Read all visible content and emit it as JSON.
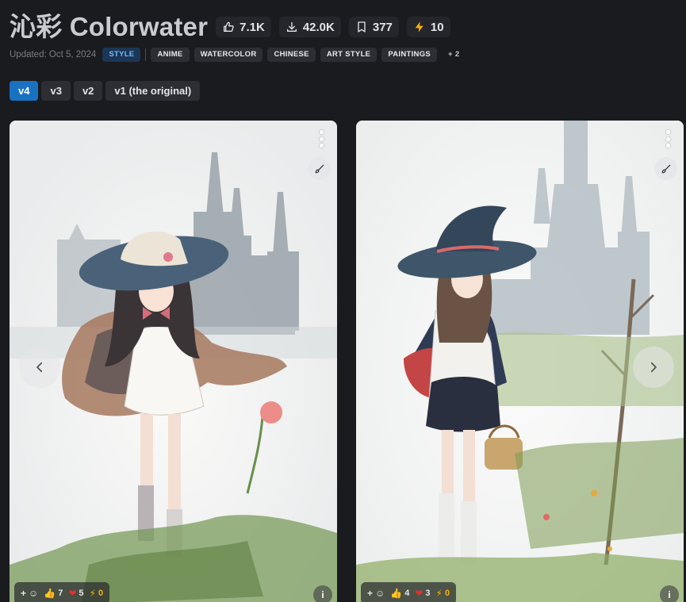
{
  "model": {
    "title": "沁彩 Colorwater",
    "stats": {
      "likes": "7.1K",
      "downloads": "42.0K",
      "bookmarks": "377",
      "buzz": "10"
    },
    "updated": "Updated: Oct 5, 2024",
    "type_tag": "STYLE",
    "tags": [
      "ANIME",
      "WATERCOLOR",
      "CHINESE",
      "ART STYLE",
      "PAINTINGS"
    ],
    "more_tags": "+ 2"
  },
  "versions": [
    {
      "label": "v4",
      "active": true
    },
    {
      "label": "v3",
      "active": false
    },
    {
      "label": "v2",
      "active": false
    },
    {
      "label": "v1 (the original)",
      "active": false
    }
  ],
  "gallery": [
    {
      "image_description": "watercolor anime girl in wide witch hat and cape with castle",
      "reactions": {
        "add": "+",
        "thumbs": "7",
        "hearts": "5",
        "buzz": "0"
      }
    },
    {
      "image_description": "watercolor anime witch holding basket with castle",
      "reactions": {
        "add": "+",
        "thumbs": "4",
        "hearts": "3",
        "buzz": "0"
      }
    }
  ],
  "icons": {
    "like": "thumbs-up-icon",
    "download": "download-icon",
    "bookmark": "bookmark-icon",
    "buzz": "bolt-icon",
    "menu": "more-vertical-icon",
    "remix": "brush-icon",
    "prev": "chevron-left-icon",
    "next": "chevron-right-icon"
  },
  "colors": {
    "background": "#1a1b1e",
    "accent": "#1971c2",
    "style_tag": "#1c3656",
    "buzz": "#fab005"
  }
}
